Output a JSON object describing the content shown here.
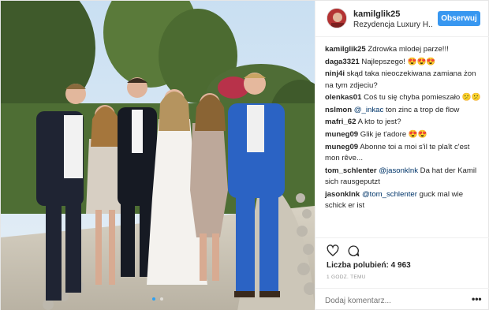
{
  "header": {
    "username": "kamilglik25",
    "location": "Rezydencja Luxury H...",
    "follow_label": "Obserwuj"
  },
  "comments": [
    {
      "user": "kamilglik25",
      "text": "Zdrowka mlodej parze!!!",
      "mention": ""
    },
    {
      "user": "daga3321",
      "text": "Najlepszego! 😍😍😍",
      "mention": ""
    },
    {
      "user": "ninj4i",
      "text": "skąd taka nieoczekiwana zamiana żon na tym zdjeciu?",
      "mention": ""
    },
    {
      "user": "olenkas01",
      "text": "Coś tu się chyba pomieszało 😕😕",
      "mention": ""
    },
    {
      "user": "nslmon",
      "text": "ton zinc a trop de flow",
      "mention": "@_inkac"
    },
    {
      "user": "mafri_62",
      "text": "A kto to jest?",
      "mention": ""
    },
    {
      "user": "muneg09",
      "text": "Glik je t'adore 😍😍",
      "mention": ""
    },
    {
      "user": "muneg09",
      "text": "Abonne toi a moi s'il te plaît c'est mon rêve...",
      "mention": ""
    },
    {
      "user": "tom_schlenter",
      "text": "Da hat der Kamil sich rausgeputzt",
      "mention": "@jasonklnk"
    },
    {
      "user": "jasonklnk",
      "text": "guck mal wie schick er ist",
      "mention": "@tom_schlenter"
    }
  ],
  "actions": {
    "like_icon": "heart-icon",
    "comment_icon": "speech-bubble-icon"
  },
  "likes": {
    "label": "Liczba polubień:",
    "count": "4 963"
  },
  "timestamp": "1 GODZ. TEMU",
  "add_comment": {
    "placeholder": "Dodaj komentarz...",
    "more_label": "•••"
  },
  "carousel": {
    "count": 2,
    "active": 1
  },
  "colors": {
    "follow_button": "#3897f0",
    "mention": "#003569",
    "avatar": "#b33333"
  }
}
